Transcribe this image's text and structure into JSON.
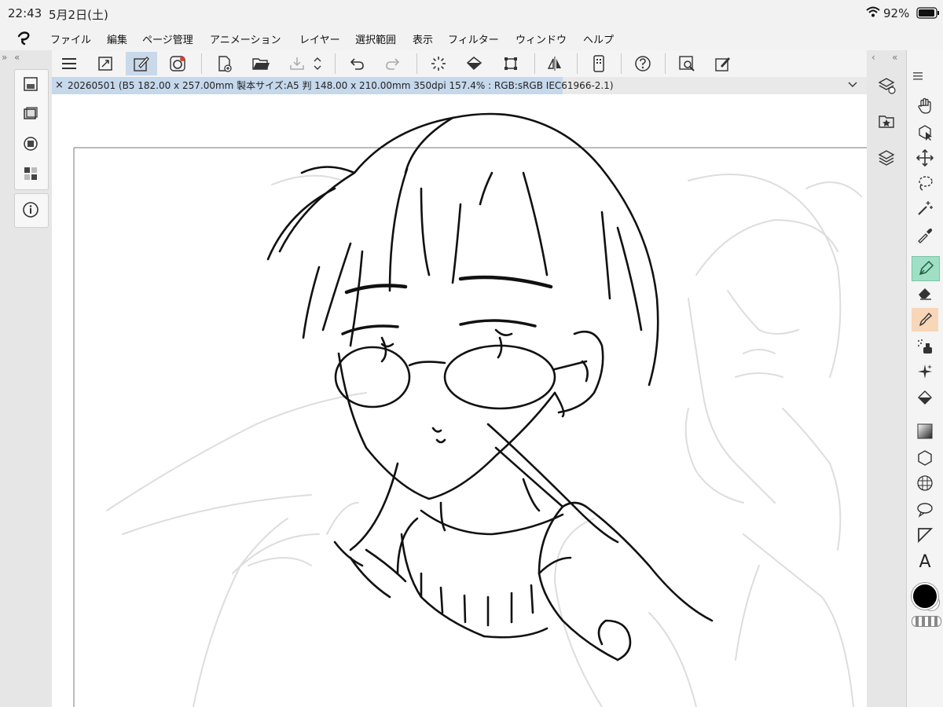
{
  "status": {
    "time": "22:43",
    "date": "5月2日(土)",
    "battery": "92%"
  },
  "menu": {
    "items": [
      "ファイル",
      "編集",
      "ページ管理",
      "アニメーション",
      "レイヤー",
      "選択範囲",
      "表示",
      "フィルター",
      "ウィンドウ",
      "ヘルプ"
    ]
  },
  "tab": {
    "title": "20260501 (B5 182.00 x 257.00mm 製本サイズ:A5 判 148.00 x 210.00mm 350dpi 157.4% : RGB:sRGB IEC61966-2.1)"
  },
  "text_tool_label": "A",
  "colors": {
    "accent": "#c9d9ea",
    "tab_bg": "#c5d8ec",
    "pen_selected": "#9fe0c4",
    "brush_selected": "#f8d6b8",
    "main_color": "#000000"
  }
}
